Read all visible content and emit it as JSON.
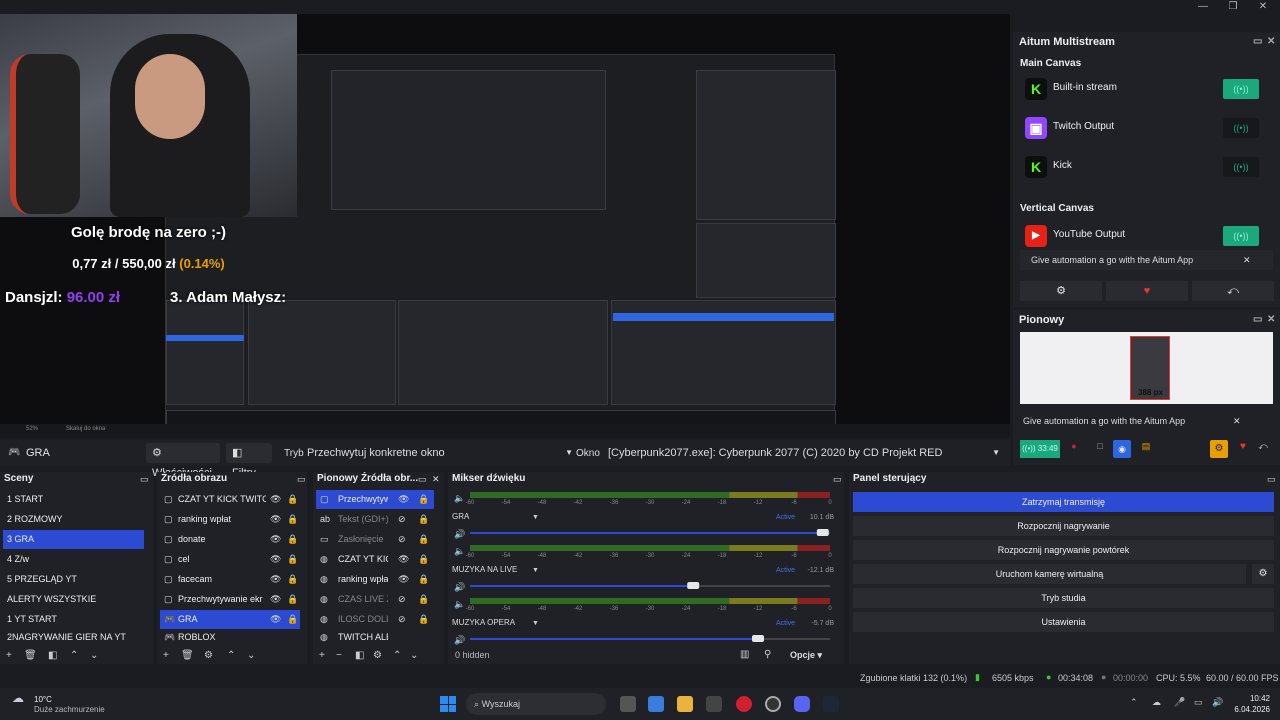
{
  "window": {
    "minimize": "—",
    "maximize": "❐",
    "close": "✕"
  },
  "overlay": {
    "goal_title": "Golę brodę na zero ;-)",
    "goal_current": "0,77 zł",
    "goal_sep": " / ",
    "goal_target": "550,00 zł",
    "goal_pct": "(0.14%)",
    "donor_name": "Dansjzl:",
    "donor_amount": "96.00 zł",
    "top3": "3. Adam Małysz:"
  },
  "preview_status": {
    "zoom": "52%",
    "scale_label": "Skaluj do okna"
  },
  "source_toolbar": {
    "selected_source": "GRA",
    "properties_label": "Właściwości",
    "filters_label": "Filtry",
    "mode_label": "Tryb",
    "mode_value": "Przechwytuj konkretne okno",
    "window_label": "Okno",
    "window_value": "[Cyberpunk2077.exe]: Cyberpunk 2077 (C) 2020 by CD Projekt RED"
  },
  "multistream": {
    "title": "Aitum Multistream",
    "main_canvas_label": "Main Canvas",
    "outputs": [
      {
        "name": "Built-in stream",
        "icon": "kick-icon",
        "active": true
      },
      {
        "name": "Twitch Output",
        "icon": "twitch-icon",
        "active": false
      },
      {
        "name": "Kick",
        "icon": "kick-icon",
        "active": false
      }
    ],
    "vertical_canvas_label": "Vertical Canvas",
    "vertical_outputs": [
      {
        "name": "YouTube Output",
        "icon": "youtube-icon",
        "active": true
      }
    ],
    "automation_text": "Give automation a go with the Aitum App",
    "dismiss": "✕"
  },
  "pionowy": {
    "title": "Pionowy",
    "size_label": "388 px",
    "automation_text": "Give automation a go with the Aitum App",
    "dismiss": "✕",
    "timer": "33:49"
  },
  "scenes": {
    "title": "Sceny",
    "items": [
      "1 START",
      "2 ROZMOWY",
      "3 GRA",
      "4 Z/w",
      "5 PRZEGLĄD YT",
      "ALERTY WSZYSTKIE",
      "1 YT START",
      "2NAGRYWANIE GIER NA YT"
    ],
    "active_index": 2
  },
  "sources": {
    "title": "Źródła obrazu",
    "items": [
      "CZAT YT KICK TWITCH",
      "ranking wpłat",
      "donate",
      "cel",
      "facecam",
      "Przechwytywanie ekr",
      "GRA",
      "ROBLOX"
    ],
    "active_index": 6
  },
  "vertical_sources": {
    "title": "Pionowy Źródła obr...",
    "items": [
      "Przechwytyw",
      "Tekst (GDI+)",
      "Zasłonięcie",
      "CZAT YT KICK",
      "ranking wpła",
      "CZAS LIVE ZA",
      "ILOSC DOLLOS",
      "TWITCH ALE"
    ],
    "active_index": 0
  },
  "mixer": {
    "title": "Mikser dźwięku",
    "ticks": [
      "-60",
      "-54",
      "-48",
      "-42",
      "-36",
      "-30",
      "-24",
      "-18",
      "-12",
      "-6",
      "0"
    ],
    "channels": [
      {
        "name": "GRA",
        "status": "Active",
        "db": "10.1 dB",
        "level": 0.98
      },
      {
        "name": "MUZYKA NA LIVE",
        "status": "Active",
        "db": "-12.1 dB",
        "level": 0.62
      },
      {
        "name": "MUZYKA OPERA",
        "status": "Active",
        "db": "-5.7 dB",
        "level": 0.8
      }
    ],
    "hidden_label": "0 hidden",
    "options_label": "Opcje"
  },
  "control": {
    "title": "Panel sterujący",
    "buttons": [
      "Zatrzymaj transmisję",
      "Rozpocznij nagrywanie",
      "Rozpocznij nagrywanie powtórek",
      "Uruchom kamerę wirtualną",
      "Tryb studia",
      "Ustawienia"
    ]
  },
  "status": {
    "dropped": "Zgubione klatki 132 (0.1%)",
    "bitrate": "6505 kbps",
    "live_time": "00:34:08",
    "rec_time": "00:00:00",
    "cpu": "CPU: 5.5%",
    "fps": "60.00 / 60.00 FPS"
  },
  "taskbar": {
    "weather_temp": "10°C",
    "weather_desc": "Duże zachmurzenie",
    "search": "Wyszukaj",
    "time": "10:42",
    "date": "6.04.2026"
  },
  "colors": {
    "accent": "#2c4bd2",
    "toggle_on": "#1aa87c",
    "twitch": "#9146ff",
    "kick": "#1a1a1a",
    "youtube": "#e62117"
  }
}
